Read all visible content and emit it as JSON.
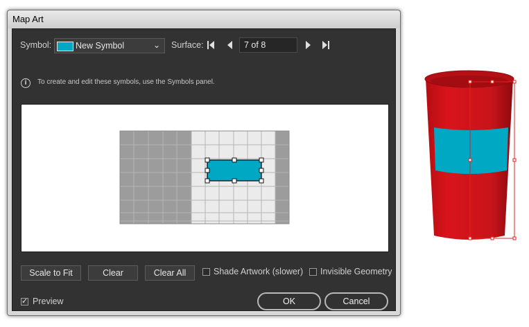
{
  "window": {
    "title": "Map Art"
  },
  "toolbar": {
    "symbol_label": "Symbol:",
    "symbol_value": "New Symbol",
    "surface_label": "Surface:",
    "surface_value": "7 of 8"
  },
  "info": {
    "text": "To create and edit these symbols, use the Symbols panel."
  },
  "buttons": {
    "scale_to_fit": "Scale to Fit",
    "clear": "Clear",
    "clear_all": "Clear All",
    "ok": "OK",
    "cancel": "Cancel"
  },
  "options": {
    "shade_artwork": {
      "label": "Shade Artwork (slower)",
      "checked": false
    },
    "invisible_geometry": {
      "label": "Invisible Geometry",
      "checked": false
    },
    "preview": {
      "label": "Preview",
      "checked": true
    }
  },
  "icons": {
    "info": "info-icon",
    "first": "first-surface-icon",
    "prev": "previous-surface-icon",
    "next": "next-surface-icon",
    "last": "last-surface-icon",
    "dropdown": "chevron-down-icon"
  },
  "colors": {
    "symbol": "#00a8c4",
    "cup": "#c8141a",
    "selection": "#e02020",
    "dialog_bg": "#323232"
  }
}
